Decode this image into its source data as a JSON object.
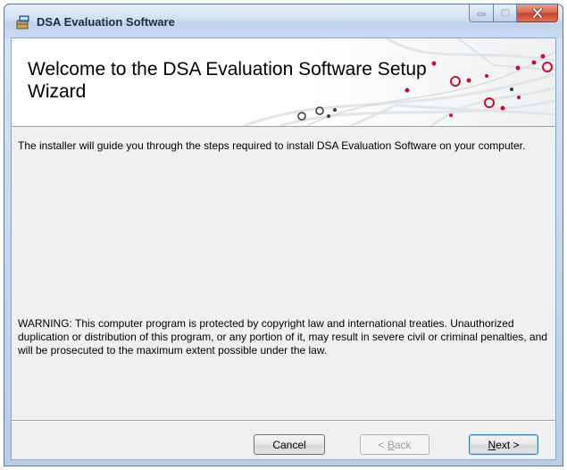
{
  "window": {
    "title": "DSA Evaluation Software",
    "icon": "installer-package-icon"
  },
  "window_controls": {
    "minimize_icon": "minimize-icon",
    "maximize_icon": "maximize-icon",
    "close_icon": "close-icon"
  },
  "banner": {
    "title": "Welcome to the DSA Evaluation Software Setup Wizard"
  },
  "content": {
    "intro": "The installer will guide you through the steps required to install DSA Evaluation Software on your computer.",
    "warning": "WARNING: This computer program is protected by copyright law and international treaties. Unauthorized duplication or distribution of this program, or any portion of it, may result in severe civil or criminal penalties, and will be prosecuted to the maximum extent possible under the law."
  },
  "buttons": {
    "cancel": "Cancel",
    "back_prefix": "< ",
    "back_mnemonic": "B",
    "back_rest": "ack",
    "back_enabled": false,
    "next_mnemonic": "N",
    "next_rest": "ext >"
  },
  "colors": {
    "accent_red": "#c8102e",
    "close_button": "#c7442a",
    "title_bar": "#c9daef"
  }
}
